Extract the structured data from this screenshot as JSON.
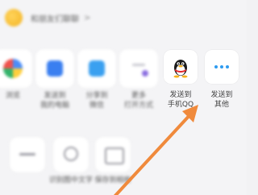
{
  "share_sheet": {
    "header_title": "和朋友们聊聊",
    "header_chevron": ">",
    "actions_row1": [
      {
        "label": "浏览"
      },
      {
        "label": "发送到\n我的电脑"
      },
      {
        "label": "分享到\n微信"
      },
      {
        "label": "更多\n打开方式"
      }
    ],
    "send_to_phone_qq": {
      "label": "发送到\n手机QQ",
      "icon": "qq-penguin-icon"
    },
    "send_to_other": {
      "label": "发送到\n其他",
      "icon": "more-dots-icon"
    },
    "actions_row2": [
      {
        "label": ""
      },
      {
        "label": "识别图中文字"
      },
      {
        "label": "保存到相册"
      }
    ],
    "annotation_arrow": {
      "color": "#f08a3c",
      "points_to": "send_to_other"
    }
  }
}
